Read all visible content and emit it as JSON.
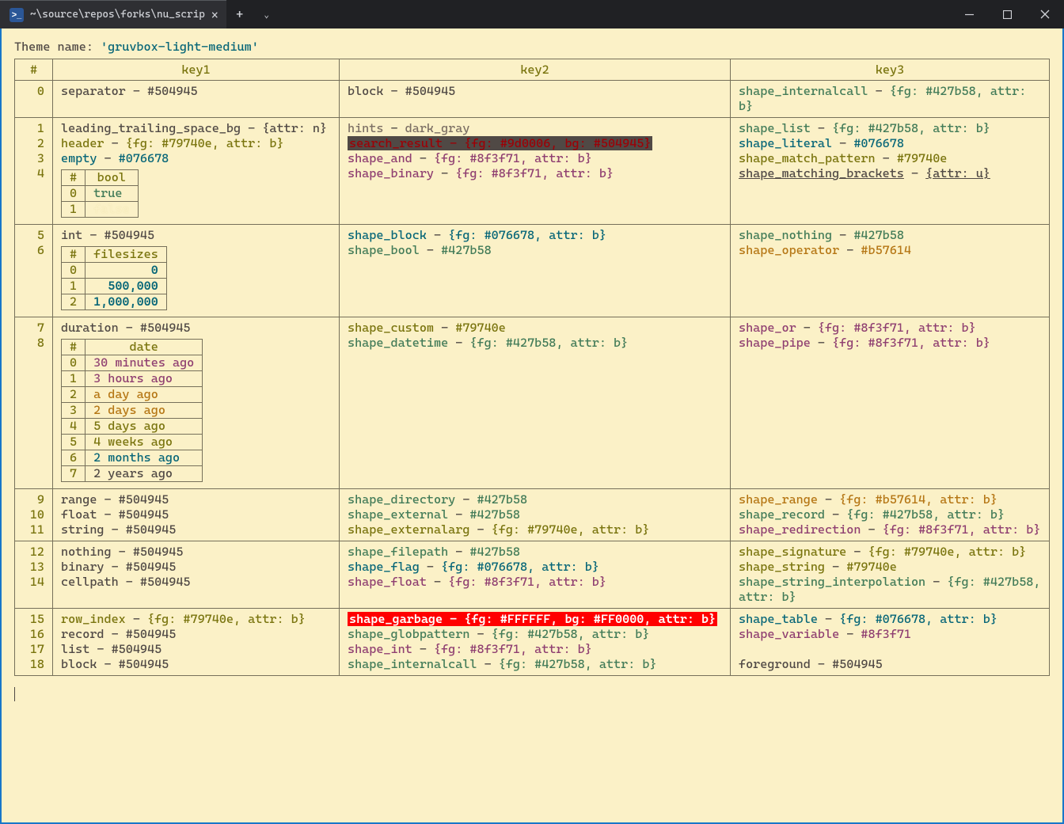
{
  "window": {
    "tab_title": "~\\source\\repos\\forks\\nu_scrip",
    "new_tab_tooltip": "New tab",
    "dropdown_tooltip": "More"
  },
  "theme_label": "Theme name:",
  "theme_name": "'gruvbox-light-medium'",
  "c": {
    "gray": "#504945",
    "green": "#427b58",
    "yellow": "#79740e",
    "cyan": "#076678",
    "pink": "#8f3f71",
    "orange": "#b57614",
    "bgred": "#FF0000",
    "white": "#FFFFFF"
  },
  "headers": [
    "#",
    "key1",
    "key2",
    "key3"
  ],
  "rows": [
    {
      "idx": [
        0
      ],
      "k1": [
        {
          "key": "separator",
          "val": "#504945",
          "cls": "v-gray"
        }
      ],
      "k2": [
        {
          "key": "block",
          "val": "#504945",
          "cls": "v-gray"
        }
      ],
      "k3": [
        {
          "key": "shape_internalcall",
          "val": "{fg: #427b58, attr: b}",
          "cls": "v-green",
          "wrap": true
        }
      ]
    },
    {
      "idx": [
        1,
        2,
        3,
        4
      ],
      "k1": [
        {
          "key": "leading_trailing_space_bg",
          "val": "{attr: n}",
          "cls": "v-gray"
        },
        {
          "key": "header",
          "val": "{fg: #79740e, attr: b}",
          "cls": "v-yellow"
        },
        {
          "key": "empty",
          "val": "#076678",
          "cls": "v-cyan"
        },
        {
          "nested": "bool"
        }
      ],
      "k2": [
        {
          "key": "hints",
          "val": "dark_gray",
          "cls": "v-dgray"
        },
        {
          "key": "search_result",
          "val": "{fg: #9d0006, bg: #504945}",
          "hl": "dark"
        },
        {
          "key": "shape_and",
          "val": "{fg: #8f3f71, attr: b}",
          "cls": "v-pink"
        },
        {
          "key": "shape_binary",
          "val": "{fg: #8f3f71, attr: b}",
          "cls": "v-pink"
        }
      ],
      "k3": [
        {
          "key": "shape_list",
          "val": "{fg: #427b58, attr: b}",
          "cls": "v-green"
        },
        {
          "key": "shape_literal",
          "val": "#076678",
          "cls": "v-cyan"
        },
        {
          "key": "shape_match_pattern",
          "val": "#79740e",
          "cls": "v-yellow"
        },
        {
          "key": "shape_matching_brackets",
          "val": "{attr: u}",
          "cls": "v-gray v-under"
        }
      ]
    },
    {
      "idx": [
        5,
        6
      ],
      "k1": [
        {
          "key": "int",
          "val": "#504945",
          "cls": "v-gray"
        },
        {
          "nested": "filesizes"
        }
      ],
      "k2": [
        {
          "key": "shape_block",
          "val": "{fg: #076678, attr: b}",
          "cls": "v-cyan"
        },
        {
          "key": "shape_bool",
          "val": "#427b58",
          "cls": "v-green"
        }
      ],
      "k3": [
        {
          "key": "shape_nothing",
          "val": "#427b58",
          "cls": "v-green"
        },
        {
          "key": "shape_operator",
          "val": "#b57614",
          "cls": "v-orange"
        }
      ]
    },
    {
      "idx": [
        7,
        8
      ],
      "k1": [
        {
          "key": "duration",
          "val": "#504945",
          "cls": "v-gray"
        },
        {
          "nested": "date"
        }
      ],
      "k2": [
        {
          "key": "shape_custom",
          "val": "#79740e",
          "cls": "v-yellow"
        },
        {
          "key": "shape_datetime",
          "val": "{fg: #427b58, attr: b}",
          "cls": "v-green"
        }
      ],
      "k3": [
        {
          "key": "shape_or",
          "val": "{fg: #8f3f71, attr: b}",
          "cls": "v-pink"
        },
        {
          "key": "shape_pipe",
          "val": "{fg: #8f3f71, attr: b}",
          "cls": "v-pink"
        }
      ]
    },
    {
      "idx": [
        9,
        10,
        11
      ],
      "k1": [
        {
          "key": "range",
          "val": "#504945",
          "cls": "v-gray"
        },
        {
          "key": "float",
          "val": "#504945",
          "cls": "v-gray"
        },
        {
          "key": "string",
          "val": "#504945",
          "cls": "v-gray"
        }
      ],
      "k2": [
        {
          "key": "shape_directory",
          "val": "#427b58",
          "cls": "v-green"
        },
        {
          "key": "shape_external",
          "val": "#427b58",
          "cls": "v-green"
        },
        {
          "key": "shape_externalarg",
          "val": "{fg: #79740e, attr: b}",
          "cls": "v-yellow"
        }
      ],
      "k3": [
        {
          "key": "shape_range",
          "val": "{fg: #b57614, attr: b}",
          "cls": "v-orange"
        },
        {
          "key": "shape_record",
          "val": "{fg: #427b58, attr: b}",
          "cls": "v-green"
        },
        {
          "key": "shape_redirection",
          "val": "{fg: #8f3f71, attr: b}",
          "cls": "v-pink",
          "wrap": true
        }
      ]
    },
    {
      "idx": [
        12,
        13,
        14
      ],
      "k1": [
        {
          "key": "nothing",
          "val": "#504945",
          "cls": "v-gray"
        },
        {
          "key": "binary",
          "val": "#504945",
          "cls": "v-gray"
        },
        {
          "key": "cellpath",
          "val": "#504945",
          "cls": "v-gray"
        }
      ],
      "k2": [
        {
          "key": "shape_filepath",
          "val": "#427b58",
          "cls": "v-green"
        },
        {
          "key": "shape_flag",
          "val": "{fg: #076678, attr: b}",
          "cls": "v-cyan"
        },
        {
          "key": "shape_float",
          "val": "{fg: #8f3f71, attr: b}",
          "cls": "v-pink"
        }
      ],
      "k3": [
        {
          "key": "shape_signature",
          "val": "{fg: #79740e, attr: b}",
          "cls": "v-yellow"
        },
        {
          "key": "shape_string",
          "val": "#79740e",
          "cls": "v-yellow"
        },
        {
          "key": "shape_string_interpolation",
          "val": "{fg: #427b58, attr: b}",
          "cls": "v-green",
          "wrap": true
        }
      ]
    },
    {
      "idx": [
        15,
        16,
        17,
        18
      ],
      "k1": [
        {
          "key": "row_index",
          "val": "{fg: #79740e, attr: b}",
          "cls": "v-yellow"
        },
        {
          "key": "record",
          "val": "#504945",
          "cls": "v-gray"
        },
        {
          "key": "list",
          "val": "#504945",
          "cls": "v-gray"
        },
        {
          "key": "block",
          "val": "#504945",
          "cls": "v-gray"
        }
      ],
      "k2": [
        {
          "key": "shape_garbage",
          "val": "{fg: #FFFFFF, bg: #FF0000, attr: b}",
          "hl": "red"
        },
        {
          "key": "shape_globpattern",
          "val": "{fg: #427b58, attr: b}",
          "cls": "v-green"
        },
        {
          "key": "shape_int",
          "val": "{fg: #8f3f71, attr: b}",
          "cls": "v-pink"
        },
        {
          "key": "shape_internalcall",
          "val": "{fg: #427b58, attr: b}",
          "cls": "v-green"
        }
      ],
      "k3": [
        {
          "key": "shape_table",
          "val": "{fg: #076678, attr: b}",
          "cls": "v-cyan"
        },
        {
          "key": "shape_variable",
          "val": "#8f3f71",
          "cls": "v-pink"
        },
        {
          "blank": true
        },
        {
          "key": "foreground",
          "val": "#504945",
          "cls": "v-gray"
        }
      ]
    }
  ],
  "nested": {
    "bool": {
      "header": "bool",
      "rows": [
        {
          "i": 0,
          "v": "true",
          "cls": "v-green"
        },
        {
          "i": 1,
          "v": "false",
          "cls": "dup-false"
        }
      ]
    },
    "filesizes": {
      "header": "filesizes",
      "rows": [
        {
          "i": 0,
          "v": "0"
        },
        {
          "i": 1,
          "v": "500,000"
        },
        {
          "i": 2,
          "v": "1,000,000"
        }
      ]
    },
    "date": {
      "header": "date",
      "rows": [
        {
          "i": 0,
          "v": "30 minutes ago",
          "cls": "v-pink"
        },
        {
          "i": 1,
          "v": "3 hours ago",
          "cls": "v-pink"
        },
        {
          "i": 2,
          "v": "a day ago",
          "cls": "v-orange"
        },
        {
          "i": 3,
          "v": "2 days ago",
          "cls": "v-orange"
        },
        {
          "i": 4,
          "v": "5 days ago",
          "cls": "v-yellow"
        },
        {
          "i": 5,
          "v": "4 weeks ago",
          "cls": "v-yellow"
        },
        {
          "i": 6,
          "v": "2 months ago",
          "cls": "v-cyan"
        },
        {
          "i": 7,
          "v": "2 years ago",
          "cls": "v-gray"
        }
      ]
    }
  }
}
